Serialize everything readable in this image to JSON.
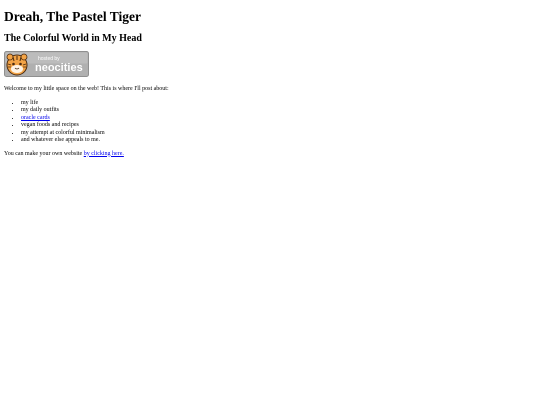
{
  "page": {
    "title": "Dreah, The Pastel Tiger",
    "subtitle": "The Colorful World in My Head"
  },
  "badge": {
    "small_text": "hosted by",
    "brand_text": "neocities",
    "icon": "tiger-mascot-icon",
    "colors": {
      "background": "#b0b0b0",
      "border": "#8f8f8f",
      "text": "#ffffff",
      "tiger_orange": "#f3a447",
      "tiger_stripes": "#4a2a10"
    }
  },
  "intro": "Welcome to my little space on the web! This is where I'll post about:",
  "topics": [
    {
      "text": "my life",
      "link": false
    },
    {
      "text": "my daily outfits",
      "link": false
    },
    {
      "text": "oracle cards",
      "link": true
    },
    {
      "text": "vegan foods and recipes",
      "link": false
    },
    {
      "text": "my attempt at colorful minimalism",
      "link": false
    },
    {
      "text": "and whatever else appeals to me.",
      "link": false
    }
  ],
  "footer": {
    "prefix": "You can make your own website ",
    "link_text": "by clicking here."
  },
  "colors": {
    "link": "#0000ee",
    "text": "#000000",
    "background": "#ffffff"
  }
}
